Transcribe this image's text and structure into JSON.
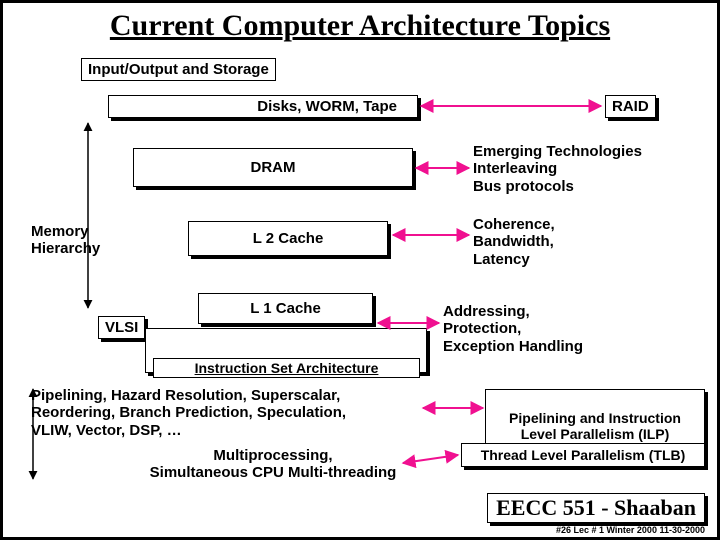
{
  "title": "Current Computer Architecture Topics",
  "labels": {
    "io_storage": "Input/Output and Storage",
    "disks": "Disks, WORM, Tape",
    "raid": "RAID",
    "dram": "DRAM",
    "emerging": "Emerging Technologies\nInterleaving\nBus protocols",
    "mem_hier": "Memory\nHierarchy",
    "l2": "L 2 Cache",
    "coherence": "Coherence,\nBandwidth,\nLatency",
    "vlsi": "VLSI",
    "l1": "L 1 Cache",
    "addressing": "Addressing,\nProtection,\nException Handling",
    "isa": "Instruction Set Architecture",
    "pipelining_left": "Pipelining, Hazard Resolution, Superscalar,\nReordering,  Branch Prediction, Speculation,\nVLIW, Vector, DSP, …",
    "multiprocessing": "Multiprocessing,\nSimultaneous CPU Multi-threading",
    "pipelining_ilp": "Pipelining and Instruction\nLevel Parallelism (ILP)",
    "tlb": "Thread Level Parallelism (TLB)"
  },
  "footer": {
    "course": "EECC 551 - Shaaban",
    "meta": "#26  Lec # 1  Winter 2000   11-30-2000"
  }
}
